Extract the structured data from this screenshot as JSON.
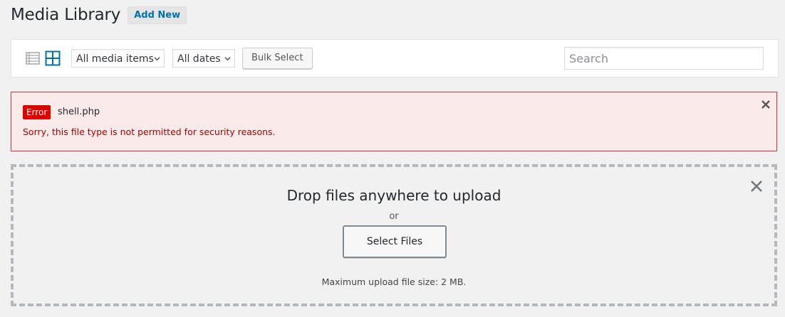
{
  "header": {
    "title": "Media Library",
    "add_new_label": "Add New"
  },
  "toolbar": {
    "list_view_icon": "list-view-icon",
    "grid_view_icon": "grid-view-icon",
    "media_filter": {
      "selected": "All media items"
    },
    "date_filter": {
      "selected": "All dates"
    },
    "bulk_select_label": "Bulk Select",
    "search": {
      "placeholder": "Search",
      "value": ""
    }
  },
  "error_notice": {
    "badge": "Error",
    "filename": "shell.php",
    "message": "Sorry, this file type is not permitted for security reasons.",
    "close_icon": "close-icon"
  },
  "uploader": {
    "title": "Drop files anywhere to upload",
    "or_text": "or",
    "select_files_label": "Select Files",
    "max_size_text": "Maximum upload file size: 2 MB.",
    "close_icon": "close-icon"
  },
  "colors": {
    "link": "#0073aa",
    "error": "#dc3232",
    "error_bg": "#fbeaea",
    "error_badge": "#dd0000",
    "grid_icon_active": "#0073aa",
    "list_icon_inactive": "#a0a5aa"
  }
}
